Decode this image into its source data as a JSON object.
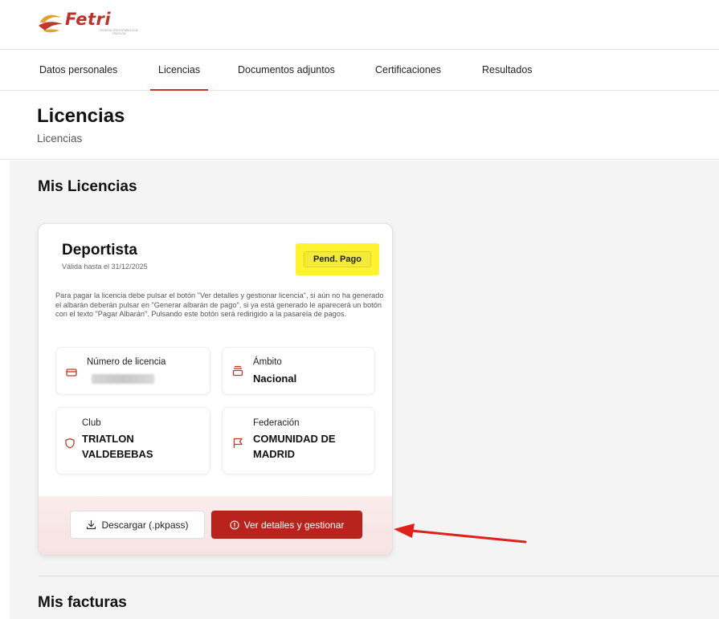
{
  "brand": {
    "name": "Fetri",
    "tagline": "FEDERACIÓN ESPAÑOLA DE TRIATLÓN"
  },
  "tabs": [
    {
      "label": "Datos personales",
      "active": false
    },
    {
      "label": "Licencias",
      "active": true
    },
    {
      "label": "Documentos adjuntos",
      "active": false
    },
    {
      "label": "Certificaciones",
      "active": false
    },
    {
      "label": "Resultados",
      "active": false
    }
  ],
  "page": {
    "title": "Licencias",
    "subtitle": "Licencias"
  },
  "sections": {
    "licenses_title": "Mis Licencias",
    "invoices_title": "Mis facturas"
  },
  "license_card": {
    "type": "Deportista",
    "valid_until": "Válida hasta el 31/12/2025",
    "status": "Pend. Pago",
    "description": "Para pagar la licencia debe pulsar el botón \"Ver detalles y gestionar licencia\", si aún no ha generado el albarán deberán pulsar en \"Generar albarán de pago\", si ya está generado le aparecerá un botón con el texto \"Pagar Albarán\". Pulsando este botón será redirigido a la pasarela de pagos.",
    "license_number_label": "Número de licencia",
    "scope_label": "Ámbito",
    "scope_value": "Nacional",
    "club_label": "Club",
    "club_value": "TRIATLON VALDEBEBAS",
    "federation_label": "Federación",
    "federation_value": "COMUNIDAD DE MADRID",
    "download_button": "Descargar (.pkpass)",
    "manage_button": "Ver detalles y gestionar"
  },
  "colors": {
    "brand_red": "#b9231d",
    "highlight_yellow": "#fff22f",
    "arrow_red": "#e0201b"
  },
  "icons": {
    "license_number": "card-icon",
    "scope": "badge-icon",
    "club": "shield-icon",
    "federation": "flag-icon",
    "download": "download-icon",
    "manage": "info-circle-icon"
  }
}
